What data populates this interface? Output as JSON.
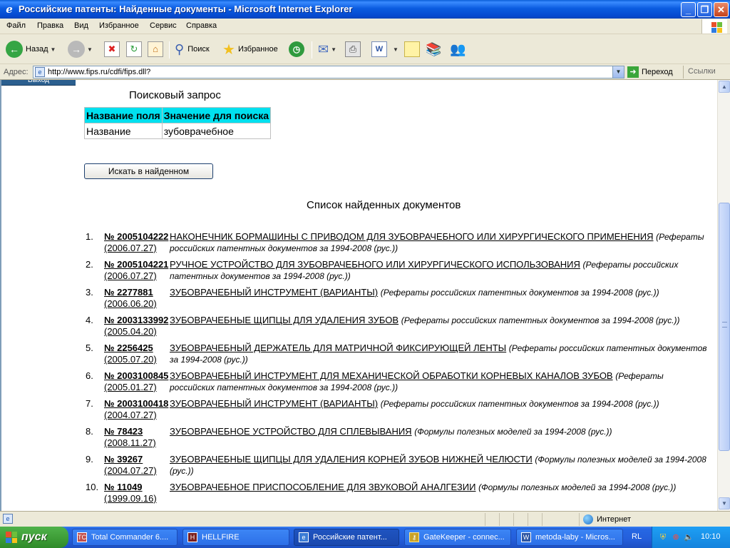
{
  "window": {
    "title": "Российские патенты: Найденные документы - Microsoft Internet Explorer",
    "icon": "ie-icon",
    "buttons": [
      "minimize",
      "maximize",
      "close"
    ]
  },
  "menu": [
    "Файл",
    "Правка",
    "Вид",
    "Избранное",
    "Сервис",
    "Справка"
  ],
  "toolbar": {
    "back": "Назад",
    "search": "Поиск",
    "favorites": "Избранное"
  },
  "address": {
    "label": "Адрес:",
    "url": "http://www.fips.ru/cdfi/fips.dll?",
    "go": "Переход",
    "links": "Ссылки"
  },
  "page": {
    "top_button": "Выход",
    "query_title": "Поисковый запрос",
    "query_table": {
      "headers": [
        "Название поля",
        "Значение для поиска"
      ],
      "rows": [
        [
          "Название",
          "зубоврачебное"
        ]
      ]
    },
    "search_in_found_button": "Искать в найденном",
    "list_title": "Список найденных документов",
    "results": [
      {
        "n": "1.",
        "num": "№ 2005104222",
        "date": "(2006.07.27)",
        "title": "НАКОНЕЧНИК БОРМАШИНЫ С ПРИВОДОМ ДЛЯ ЗУБОВРАЧЕБНОГО ИЛИ ХИРУРГИЧЕСКОГО ПРИМЕНЕНИЯ",
        "source": "(Рефераты российских патентных документов за 1994-2008 (рус.))"
      },
      {
        "n": "2.",
        "num": "№ 2005104221",
        "date": "(2006.07.27)",
        "title": "РУЧНОЕ УСТРОЙСТВО ДЛЯ ЗУБОВРАЧЕБНОГО ИЛИ ХИРУРГИЧЕСКОГО ИСПОЛЬЗОВАНИЯ",
        "source": "(Рефераты российских патентных документов за 1994-2008 (рус.))"
      },
      {
        "n": "3.",
        "num": "№ 2277881",
        "date": "(2006.06.20)",
        "title": "ЗУБОВРАЧЕБНЫЙ ИНСТРУМЕНТ (ВАРИАНТЫ)",
        "source": "(Рефераты российских патентных документов за 1994-2008 (рус.))"
      },
      {
        "n": "4.",
        "num": "№ 2003133992",
        "date": "(2005.04.20)",
        "title": "ЗУБОВРАЧЕБНЫЕ ЩИПЦЫ ДЛЯ УДАЛЕНИЯ ЗУБОВ",
        "source": "(Рефераты российских патентных документов за 1994-2008 (рус.))"
      },
      {
        "n": "5.",
        "num": "№ 2256425",
        "date": "(2005.07.20)",
        "title": "ЗУБОВРАЧЕБНЫЙ ДЕРЖАТЕЛЬ ДЛЯ МАТРИЧНОЙ ФИКСИРУЮЩЕЙ ЛЕНТЫ",
        "source": "(Рефераты российских патентных документов за 1994-2008 (рус.))"
      },
      {
        "n": "6.",
        "num": "№ 2003100845",
        "date": "(2005.01.27)",
        "title": "ЗУБОВРАЧЕБНЫЙ ИНСТРУМЕНТ ДЛЯ МЕХАНИЧЕСКОЙ ОБРАБОТКИ КОРНЕВЫХ КАНАЛОВ ЗУБОВ",
        "source": "(Рефераты российских патентных документов за 1994-2008 (рус.))"
      },
      {
        "n": "7.",
        "num": "№ 2003100418",
        "date": "(2004.07.27)",
        "title": "ЗУБОВРАЧЕБНЫЙ ИНСТРУМЕНТ (ВАРИАНТЫ)",
        "source": "(Рефераты российских патентных документов за 1994-2008 (рус.))"
      },
      {
        "n": "8.",
        "num": "№ 78423",
        "date": "(2008.11.27)",
        "title": "ЗУБОВРАЧЕБНОЕ УСТРОЙСТВО ДЛЯ СПЛЕВЫВАНИЯ",
        "source": "(Формулы полезных моделей за 1994-2008 (рус.))"
      },
      {
        "n": "9.",
        "num": "№ 39267",
        "date": "(2004.07.27)",
        "title": "ЗУБОВРАЧЕБНЫЕ ЩИПЦЫ ДЛЯ УДАЛЕНИЯ КОРНЕЙ ЗУБОВ НИЖНЕЙ ЧЕЛЮСТИ",
        "source": "(Формулы полезных моделей за 1994-2008 (рус.))"
      },
      {
        "n": "10.",
        "num": "№ 11049",
        "date": "(1999.09.16)",
        "title": "ЗУБОВРАЧЕБНОЕ ПРИСПОСОБЛЕНИЕ ДЛЯ ЗВУКОВОЙ АНАЛГЕЗИИ",
        "source": "(Формулы полезных моделей за 1994-2008 (рус.))"
      }
    ]
  },
  "status": {
    "zone": "Интернет"
  },
  "taskbar": {
    "start": "пуск",
    "tasks": [
      {
        "label": "Total Commander 6....",
        "icon": "total-commander-icon"
      },
      {
        "label": "HELLFIRE",
        "icon": "hellfire-icon"
      },
      {
        "label": "Российские патент...",
        "icon": "ie-icon",
        "active": true
      },
      {
        "label": "GateKeeper - connec...",
        "icon": "key-icon"
      },
      {
        "label": "metoda-laby - Micros...",
        "icon": "word-icon"
      }
    ],
    "lang": "RL",
    "clock": "10:10"
  },
  "colors": {
    "title_bar": "#0b5ce0",
    "table_header": "#00e0ef",
    "start_button": "#3c9b35",
    "taskbar": "#245edb"
  }
}
